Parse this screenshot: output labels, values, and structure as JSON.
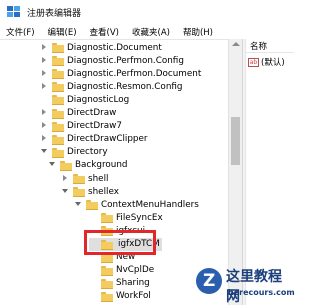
{
  "window": {
    "title": "注册表编辑器"
  },
  "menu": [
    "文件(F)",
    "编辑(E)",
    "查看(V)",
    "收藏夹(A)",
    "帮助(H)"
  ],
  "tree": [
    {
      "label": "Diagnostic.Document",
      "level": 0,
      "caret": "closed"
    },
    {
      "label": "Diagnostic.Perfmon.Config",
      "level": 0,
      "caret": "closed"
    },
    {
      "label": "Diagnostic.Perfmon.Document",
      "level": 0,
      "caret": "closed"
    },
    {
      "label": "Diagnostic.Resmon.Config",
      "level": 0,
      "caret": "closed"
    },
    {
      "label": "DiagnosticLog",
      "level": 0,
      "caret": "none"
    },
    {
      "label": "DirectDraw",
      "level": 0,
      "caret": "closed"
    },
    {
      "label": "DirectDraw7",
      "level": 0,
      "caret": "closed"
    },
    {
      "label": "DirectDrawClipper",
      "level": 0,
      "caret": "closed"
    },
    {
      "label": "Directory",
      "level": 0,
      "caret": "open"
    },
    {
      "label": "Background",
      "level": 1,
      "caret": "open"
    },
    {
      "label": "shell",
      "level": 2,
      "caret": "closed"
    },
    {
      "label": "shellex",
      "level": 2,
      "caret": "open"
    },
    {
      "label": "ContextMenuHandlers",
      "level": 3,
      "caret": "open"
    },
    {
      "label": "FileSyncEx",
      "level": 4,
      "caret": "none"
    },
    {
      "label": "igfxcui",
      "level": 4,
      "caret": "none"
    },
    {
      "label": "igfxDTCM",
      "level": 4,
      "caret": "none",
      "selected": true
    },
    {
      "label": "New",
      "level": 4,
      "caret": "none"
    },
    {
      "label": "NvCplDe",
      "level": 4,
      "caret": "none"
    },
    {
      "label": "Sharing",
      "level": 4,
      "caret": "none"
    },
    {
      "label": "WorkFol",
      "level": 4,
      "caret": "none"
    }
  ],
  "list": {
    "column_name": "名称",
    "rows": [
      {
        "icon": "ab",
        "name": "(默认)"
      }
    ]
  },
  "watermark": {
    "title": "这里教程网",
    "subtitle": "herecours.com"
  }
}
